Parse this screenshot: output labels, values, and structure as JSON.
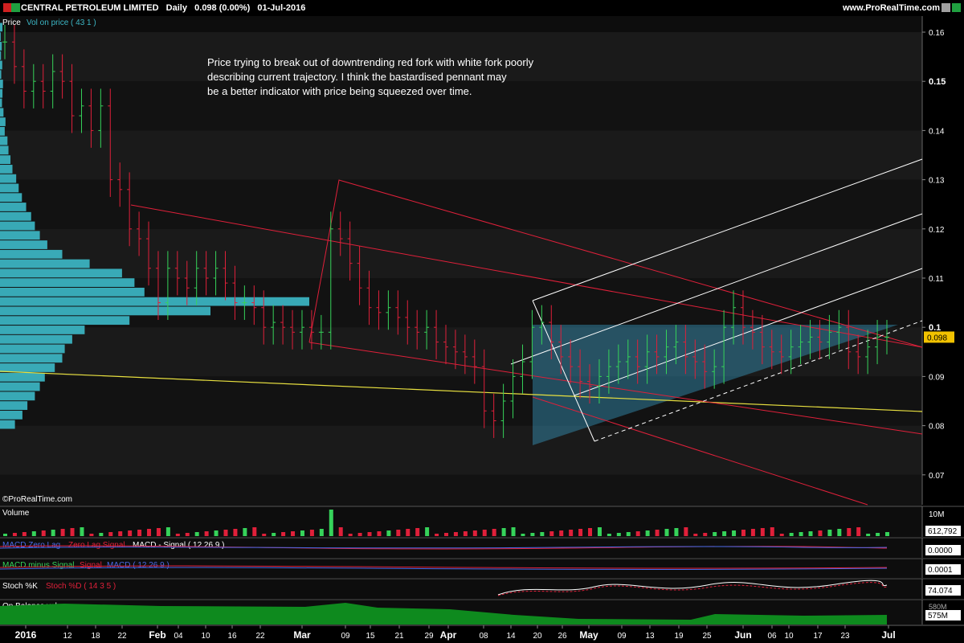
{
  "header": {
    "title": "CENTRAL PETROLEUM LIMITED   Daily   0.098 (0.00%)   01-Jul-2016",
    "website": "www.ProRealTime.com"
  },
  "copyright": "©ProRealTime.com",
  "annotation": [
    "Price trying to break out of downtrending red fork with white fork poorly",
    "describing current trajectory. I think the bastardised pennant may",
    "be a better indicator with price being squeezed over time."
  ],
  "panels": {
    "price": {
      "label": "Price",
      "sublabel": "Vol on price ( 43 1 )"
    },
    "volume": {
      "label": "Volume",
      "top_tick": "10M",
      "last": "612,792"
    },
    "macd1": {
      "label": "MACD Zero Lag",
      "label2": "Zero Lag Signal",
      "label3": "MACD - Signal ( 12 26 9 )",
      "last": "0.0000"
    },
    "macd2": {
      "label": "MACD minus Signal",
      "label2": "Signal",
      "label3": "MACD ( 12 26 9 )",
      "last": "0.0001"
    },
    "stoch": {
      "label": "Stoch %K",
      "label2": "Stoch %D ( 14 3 5 )",
      "last": "74.074"
    },
    "obv": {
      "label": "On Balance vol",
      "tick": "580M",
      "last": "575M"
    }
  },
  "colors": {
    "up": "#36d35a",
    "down": "#e0203a",
    "red_fork": "#e0203a",
    "white_fork": "#ffffff",
    "pennant": "#3aa0c8",
    "yellow_line": "#e8e040",
    "volume_profile": "#3cb6c4",
    "obv_fill": "#0e8a1e",
    "last_price_bg": "#f2c200"
  },
  "chart_data": {
    "type": "ohlc",
    "title": "CENTRAL PETROLEUM LIMITED",
    "frequency": "Daily",
    "last_price": "0.098",
    "change": "0.00%",
    "date": "01-Jul-2016",
    "y_ticks": [
      "0.16",
      "0.15",
      "0.14",
      "0.13",
      "0.12",
      "0.11",
      "0.1",
      "0.09",
      "0.08",
      "0.07"
    ],
    "ylim": [
      0.063,
      0.163
    ],
    "x_ticks": [
      "2016",
      "12",
      "18",
      "22",
      "Feb",
      "04",
      "10",
      "16",
      "22",
      "Mar",
      "09",
      "15",
      "21",
      "29",
      "Apr",
      "08",
      "14",
      "20",
      "26",
      "May",
      "09",
      "13",
      "19",
      "25",
      "Jun",
      "06",
      "10",
      "17",
      "23",
      "Jul"
    ],
    "x_ticks_bold": [
      "2016",
      "Feb",
      "Mar",
      "Apr",
      "May",
      "Jun",
      "Jul"
    ],
    "price_path": [
      0.158,
      0.153,
      0.148,
      0.15,
      0.148,
      0.152,
      0.15,
      0.143,
      0.145,
      0.14,
      0.145,
      0.13,
      0.128,
      0.12,
      0.118,
      0.112,
      0.105,
      0.112,
      0.11,
      0.108,
      0.112,
      0.11,
      0.112,
      0.109,
      0.105,
      0.105,
      0.104,
      0.1,
      0.101,
      0.1,
      0.099,
      0.1,
      0.099,
      0.099,
      0.12,
      0.118,
      0.113,
      0.108,
      0.104,
      0.103,
      0.104,
      0.102,
      0.1,
      0.099,
      0.1,
      0.097,
      0.096,
      0.095,
      0.094,
      0.092,
      0.083,
      0.081,
      0.085,
      0.09,
      0.093,
      0.1,
      0.101,
      0.097,
      0.094,
      0.092,
      0.089,
      0.088,
      0.09,
      0.092,
      0.093,
      0.094,
      0.092,
      0.095,
      0.094,
      0.096,
      0.097,
      0.094,
      0.093,
      0.091,
      0.092,
      0.1,
      0.104,
      0.1,
      0.099,
      0.096,
      0.095,
      0.094,
      0.096,
      0.097,
      0.098,
      0.097,
      0.099,
      0.1,
      0.095,
      0.094,
      0.096,
      0.098,
      0.098
    ],
    "volume_profile": [
      1.0,
      0.3,
      0.7,
      0.4,
      0.9,
      0.5,
      1.2,
      1.0,
      0.8,
      1.4,
      2.2,
      1.9,
      3.0,
      3.4,
      4.2,
      5.0,
      6.5,
      7.5,
      8.8,
      10.5,
      12.5,
      14.0,
      16.0,
      19.0,
      25.0,
      36.0,
      49.0,
      54.0,
      58.0,
      68.0,
      62.0,
      52.0,
      34.0,
      29.0,
      26.0,
      25.0,
      22.0,
      18.0,
      16.0,
      14.0,
      11.0,
      9.0,
      6.0
    ],
    "trendlines": {
      "red_fork": [
        [
          385,
          426,
          1120,
          426,
          0.129,
          0.097,
          0.078,
          0.0
        ]
      ],
      "pennant": "shaded triangle",
      "yellow_line": "diagonal"
    },
    "volume_panel": {
      "top_tick": "10M",
      "last": "612,792"
    },
    "macd_panel": {
      "last": "0.0000"
    },
    "macd_signal_panel": {
      "last": "0.0001"
    },
    "stoch_panel": {
      "last": "74.074"
    },
    "obv_panel": {
      "tick": "580M",
      "last": "575M"
    }
  }
}
